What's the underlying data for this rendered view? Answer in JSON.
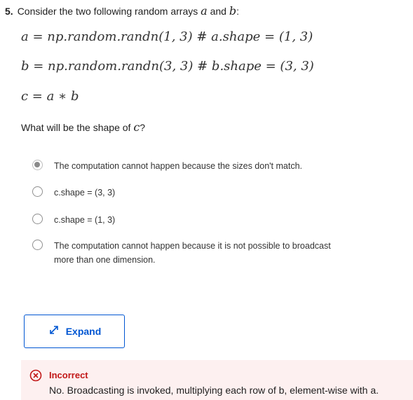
{
  "question": {
    "number": "5.",
    "text_before_a": "Consider the two following random arrays",
    "var_a": "a",
    "text_and": "and",
    "var_b": "b",
    "text_after_b": ":"
  },
  "code_lines": [
    "a = np.random.randn(1, 3) # a.shape = (1, 3)",
    "b = np.random.randn(3, 3) # b.shape = (3, 3)",
    "c = a ∗ b"
  ],
  "prompt": {
    "text_before": "What will be the shape of",
    "var_c": "c",
    "text_after": "?"
  },
  "options": [
    {
      "label": "The computation cannot happen because the sizes don't match.",
      "selected": true
    },
    {
      "label": "c.shape = (3, 3)",
      "selected": false
    },
    {
      "label": "c.shape = (1, 3)",
      "selected": false
    },
    {
      "label": "The computation cannot happen because it is not possible to broadcast more than one dimension.",
      "selected": false
    }
  ],
  "expand": {
    "label": "Expand",
    "icon": "expand-arrows-icon",
    "color": "#0056d2"
  },
  "feedback": {
    "status": "Incorrect",
    "status_color": "#c21818",
    "message": "No. Broadcasting is invoked, multiplying each row of b, element-wise with a.",
    "icon": "x-circle-icon"
  }
}
